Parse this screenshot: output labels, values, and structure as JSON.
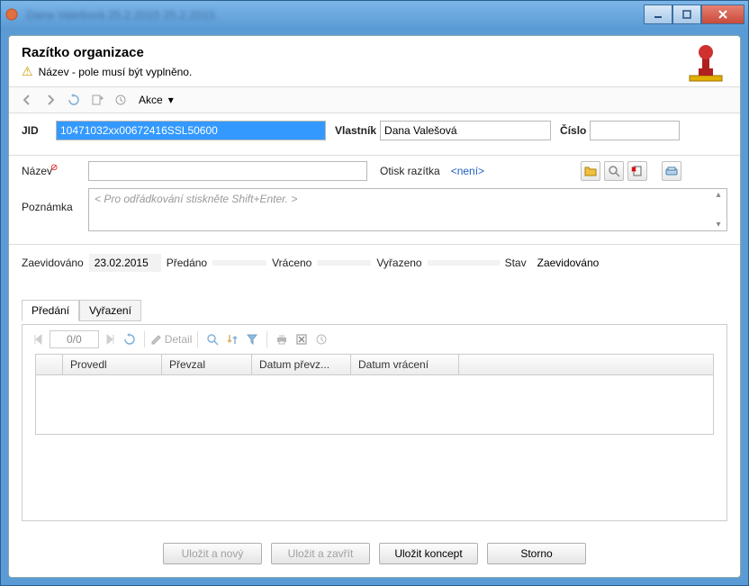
{
  "titlebar": {
    "blurred_text": "Dana Valešová          25.2.2015                    25.2.2015"
  },
  "header": {
    "title": "Razítko organizace",
    "warning": "Název - pole musí být vyplněno."
  },
  "toolbar": {
    "akce": "Akce"
  },
  "form": {
    "jid_label": "JID",
    "jid_value": "10471032xx00672416SSL50600",
    "vlastnik_label": "Vlastník",
    "vlastnik_value": "Dana Valešová",
    "cislo_label": "Číslo",
    "cislo_value": "",
    "nazev_label": "Název",
    "nazev_value": "",
    "otisk_label": "Otisk razítka",
    "otisk_value": "<není>",
    "poznamka_label": "Poznámka",
    "poznamka_placeholder": "< Pro odřádkování stiskněte Shift+Enter. >"
  },
  "status": {
    "zaevidovano_label": "Zaevidováno",
    "zaevidovano_value": "23.02.2015",
    "predano_label": "Předáno",
    "predano_value": "",
    "vraceno_label": "Vráceno",
    "vraceno_value": "",
    "vyrazeno_label": "Vyřazeno",
    "vyrazeno_value": "",
    "stav_label": "Stav",
    "stav_value": "Zaevidováno"
  },
  "tabs": {
    "predani": "Předání",
    "vyrazeni": "Vyřazení"
  },
  "pager": {
    "display": "0/0",
    "detail": "Detail"
  },
  "table": {
    "col1": "Provedl",
    "col2": "Převzal",
    "col3": "Datum převz...",
    "col4": "Datum vrácení"
  },
  "buttons": {
    "save_new": "Uložit a nový",
    "save_close": "Uložit a zavřít",
    "save_draft": "Uložit koncept",
    "cancel": "Storno"
  }
}
